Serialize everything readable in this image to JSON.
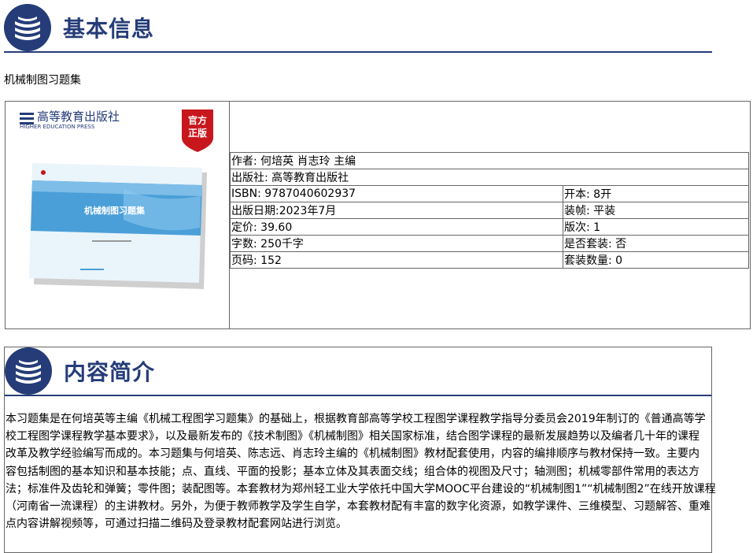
{
  "sections": {
    "basic_info_title": "基本信息",
    "intro_title": "内容简介"
  },
  "book": {
    "title": "机械制图习题集",
    "cover": {
      "publisher_logo_cn": "高等教育出版社",
      "publisher_logo_en": "HIGHER EDUCATION PRESS",
      "badge_line1": "官方",
      "badge_line2": "正版",
      "book_title_on_cover": "机械制图习题集"
    },
    "rows": [
      {
        "left": "作者: 何培英 肖志玲 主编",
        "right": null
      },
      {
        "left": "出版社: 高等教育出版社",
        "right": null
      },
      {
        "left": "ISBN: 9787040602937",
        "right": "开本: 8开"
      },
      {
        "left": "出版日期:2023年7月",
        "right": "装帧: 平装"
      },
      {
        "left": "定价: 39.60",
        "right": "版次: 1"
      },
      {
        "left": "字数: 250千字",
        "right": "是否套装: 否"
      },
      {
        "left": "页码: 152",
        "right": "套装数量: 0"
      }
    ]
  },
  "intro": {
    "lines": [
      "本习题集是在何培英等主编《机械工程图学习题集》的基础上，根据教育部高等学校工程图学课程教学指导分委员会2019年制订的《普通高等学",
      "校工程图学课程教学基本要求》，以及最新发布的《技术制图》《机械制图》相关国家标准，结合图学课程的最新发展趋势以及编者几十年的课程",
      "改革及教学经验编写而成的。本习题集与何培英、陈志远、肖志玲主编的《机械制图》教材配套使用，内容的编排顺序与教材保持一致。主要内",
      "容包括制图的基本知识和基本技能；点、直线、平面的投影；基本立体及其表面交线；组合体的视图及尺寸；轴测图；机械零部件常用的表达方",
      "法；标准件及齿轮和弹簧；零件图；装配图等。本套教材为郑州轻工业大学依托中国大学MOOC平台建设的“机械制图1”“机械制图2”在线开放课程",
      "（河南省一流课程）的主讲教材。另外，为便于教师教学及学生自学，本套教材配有丰富的数字化资源，如教学课件、三维模型、习题解答、重难",
      "点内容讲解视频等，可通过扫描二维码及登录教材配套网站进行浏览。"
    ]
  },
  "colors": {
    "brand_navy": "#253c78",
    "badge_red": "#c8161d",
    "cover_blue": "#4a9fd8"
  }
}
